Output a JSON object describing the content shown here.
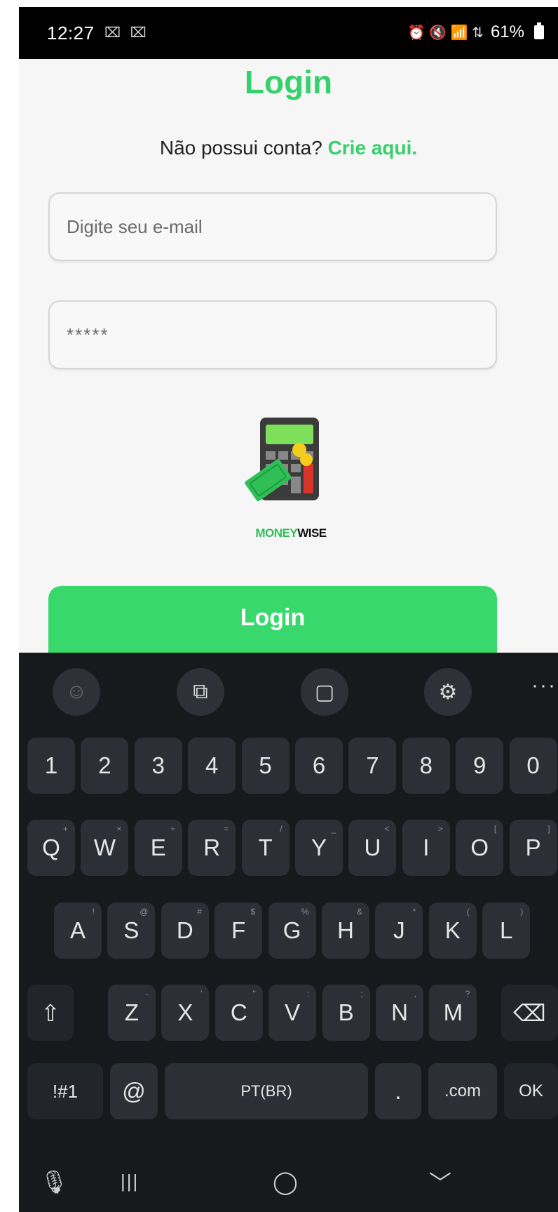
{
  "status": {
    "time": "12:27",
    "time_icons": "⌧ ⌧",
    "right_icons": "⏰ 🔇 📶 ⇅",
    "battery": "61%"
  },
  "login": {
    "title": "Login",
    "signup_text": "Não possui conta?",
    "signup_link": "Crie aqui.",
    "email_placeholder": "Digite seu e-mail",
    "password_value": "*****",
    "logo_text_a": "MONEY",
    "logo_text_b": "WISE",
    "button": "Login"
  },
  "keyboard": {
    "toolbar": [
      "emoji-icon",
      "translate-icon",
      "clipboard-icon",
      "gear-icon",
      "more-icon"
    ],
    "rows": {
      "numbers": [
        "1",
        "2",
        "3",
        "4",
        "5",
        "6",
        "7",
        "8",
        "9",
        "0"
      ],
      "qwerty": [
        {
          "k": "Q",
          "s": "+"
        },
        {
          "k": "W",
          "s": "×"
        },
        {
          "k": "E",
          "s": "÷"
        },
        {
          "k": "R",
          "s": "="
        },
        {
          "k": "T",
          "s": "/"
        },
        {
          "k": "Y",
          "s": "_"
        },
        {
          "k": "U",
          "s": "<"
        },
        {
          "k": "I",
          "s": ">"
        },
        {
          "k": "O",
          "s": "["
        },
        {
          "k": "P",
          "s": "]"
        }
      ],
      "asdf": [
        {
          "k": "A",
          "s": "!"
        },
        {
          "k": "S",
          "s": "@"
        },
        {
          "k": "D",
          "s": "#"
        },
        {
          "k": "F",
          "s": "$"
        },
        {
          "k": "G",
          "s": "%"
        },
        {
          "k": "H",
          "s": "&"
        },
        {
          "k": "J",
          "s": "*"
        },
        {
          "k": "K",
          "s": "("
        },
        {
          "k": "L",
          "s": ")"
        }
      ],
      "zxcv": [
        {
          "k": "Z",
          "s": "-"
        },
        {
          "k": "X",
          "s": "'"
        },
        {
          "k": "C",
          "s": "\""
        },
        {
          "k": "V",
          "s": ":"
        },
        {
          "k": "B",
          "s": ";"
        },
        {
          "k": "N",
          "s": ","
        },
        {
          "k": "M",
          "s": "?"
        }
      ]
    },
    "shift": "⇧",
    "backspace": "⌫",
    "symbols": "!#1",
    "at": "@",
    "space": "PT(BR)",
    "period": ".",
    "dotcom": ".com",
    "ok": "OK"
  },
  "navbar": {
    "mic": "🎙",
    "recents": "|||",
    "home": "◯",
    "back": "﹀"
  }
}
